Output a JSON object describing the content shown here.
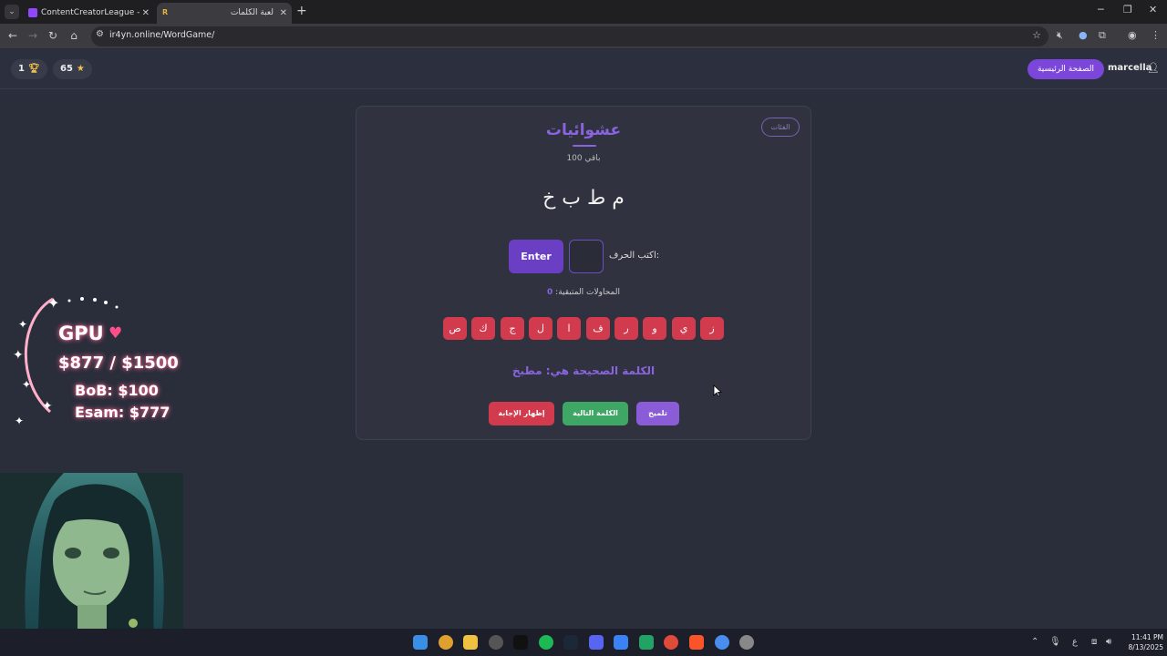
{
  "browser": {
    "tabs": [
      {
        "title": "ContentCreatorLeague - Twitch",
        "favicon": "twitch-icon",
        "active": false
      },
      {
        "title": "لعبة الكلمات",
        "favicon": "R",
        "active": true
      }
    ],
    "url": "ir4yn.online/WordGame/"
  },
  "header": {
    "trophies": "1",
    "stars": "65",
    "home_label": "الصفحة الرئيسية",
    "username": "marcella"
  },
  "game": {
    "categories_label": "الفئات",
    "category_title": "عشوائيات",
    "remaining": "باقي 100",
    "scrambled": "م ط ب خ",
    "enter_label": "Enter",
    "input_value": "",
    "input_label": "اكتب الحرف:",
    "attempts_label": "المحاولات المتبقية:",
    "attempts_count": "0",
    "letters": [
      "ص",
      "ك",
      "ج",
      "ل",
      "ا",
      "ف",
      "ر",
      "و",
      "ي",
      "ز"
    ],
    "answer_text": "الكلمة الصحيحة هي: مطبخ",
    "buttons": {
      "reveal": "إظهار الإجابة",
      "next": "الكلمة التالية",
      "hint": "تلميح"
    }
  },
  "overlay": {
    "gpu_label": "GPU",
    "gpu_amount": "$877 / $1500",
    "bob": "BoB: $100",
    "esam": "Esam: $777"
  },
  "taskbar": {
    "lang": "ع",
    "time": "11:41 PM",
    "date": "8/13/2025"
  },
  "colors": {
    "accent": "#8a64e0",
    "danger": "#d23a4d",
    "success": "#3fa765",
    "background": "#2a2d3a"
  }
}
